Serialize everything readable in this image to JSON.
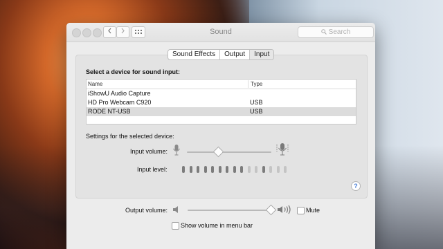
{
  "window": {
    "title": "Sound"
  },
  "toolbar": {
    "search_placeholder": "Search"
  },
  "tabs": [
    {
      "label": "Sound Effects",
      "active": false
    },
    {
      "label": "Output",
      "active": false
    },
    {
      "label": "Input",
      "active": true
    }
  ],
  "input": {
    "heading": "Select a device for sound input:",
    "columns": {
      "name": "Name",
      "type": "Type"
    },
    "devices": [
      {
        "name": "iShowU Audio Capture",
        "type": ""
      },
      {
        "name": "HD Pro Webcam C920",
        "type": "USB"
      },
      {
        "name": "RODE NT-USB",
        "type": "USB"
      }
    ],
    "selected_index": 2,
    "settings_label": "Settings for the selected device:",
    "input_volume_label": "Input volume:",
    "input_volume": 0.37,
    "input_level_label": "Input level:",
    "input_level_segments_lit": 9,
    "input_level_segments_total": 15
  },
  "output": {
    "output_volume_label": "Output volume:",
    "output_volume": 0.97,
    "mute_label": "Mute",
    "mute_checked": false,
    "show_in_menubar_label": "Show volume in menu bar",
    "show_in_menubar_checked": false
  },
  "help": {
    "label": "?"
  },
  "colors": {
    "selected_row": "#dcdcdc",
    "level_on": "#7c7c7c",
    "level_off": "#c4c4c4"
  }
}
